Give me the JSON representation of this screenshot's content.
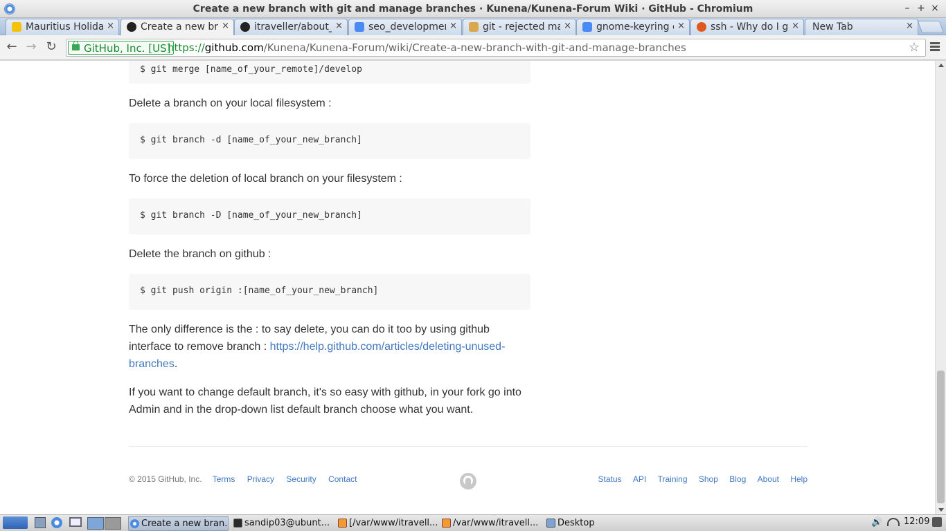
{
  "window": {
    "title": "Create a new branch with git and manage branches · Kunena/Kunena-Forum Wiki · GitHub - Chromium"
  },
  "window_controls": {
    "minimize": "–",
    "maximize": "+",
    "close": "×"
  },
  "tabs": [
    {
      "label": "Mauritius Holiday",
      "icon": "yahoo-favicon",
      "color": "#f4c20d"
    },
    {
      "label": "Create a new bran",
      "icon": "github-favicon",
      "color": "#222222",
      "active": true
    },
    {
      "label": "itraveller/about_",
      "icon": "github-favicon",
      "color": "#222222"
    },
    {
      "label": "seo_development",
      "icon": "google-docs-favicon",
      "color": "#4a8af4"
    },
    {
      "label": "git - rejected mas",
      "icon": "stackoverflow-favicon",
      "color": "#d9a84e"
    },
    {
      "label": "gnome-keyring co",
      "icon": "google-favicon",
      "color": "#4a8af4"
    },
    {
      "label": "ssh - Why do I get",
      "icon": "askubuntu-favicon",
      "color": "#e05a1f"
    },
    {
      "label": "New Tab",
      "icon": "",
      "color": ""
    }
  ],
  "tab_close": "×",
  "toolbar": {
    "back": "←",
    "forward": "→",
    "reload": "↻",
    "ev_label": "GitHub, Inc. [US]",
    "url_scheme": "https://",
    "url_host": "github.com",
    "url_path": "/Kunena/Kunena-Forum/wiki/Create-a-new-branch-with-git-and-manage-branches",
    "star": "☆"
  },
  "content": {
    "code_merge": "$ git merge [name_of_your_remote]/develop",
    "p_delete_local": "Delete a branch on your local filesystem :",
    "code_delete_local": "$ git branch -d [name_of_your_new_branch]",
    "p_force_delete": "To force the deletion of local branch on your filesystem :",
    "code_force_delete": "$ git branch -D [name_of_your_new_branch]",
    "p_delete_github": "Delete the branch on github :",
    "code_push_delete": "$ git push origin :[name_of_your_new_branch]",
    "p_difference_start": "The only difference is the : to say delete, you can do it too by using github interface to remove branch : ",
    "p_difference_link": "https://help.github.com/articles/deleting-unused-branches",
    "p_difference_end": ".",
    "p_default_branch": "If you want to change default branch, it's so easy with github, in your fork go into Admin and in the drop-down list default branch choose what you want."
  },
  "footer": {
    "copyright": "© 2015 GitHub, Inc.",
    "left_links": [
      "Terms",
      "Privacy",
      "Security",
      "Contact"
    ],
    "right_links": [
      "Status",
      "API",
      "Training",
      "Shop",
      "Blog",
      "About",
      "Help"
    ]
  },
  "taskbar": {
    "tasks": [
      {
        "label": "Create a new bran...",
        "icon": "chromium-icon",
        "active": true
      },
      {
        "label": "sandip03@ubunt...",
        "icon": "terminal-icon"
      },
      {
        "label": "[/var/www/itravell...",
        "icon": "sublime-icon"
      },
      {
        "label": "/var/www/itravell...",
        "icon": "sublime-icon"
      },
      {
        "label": "Desktop",
        "icon": "folder-icon"
      }
    ],
    "clock": "12:09"
  }
}
